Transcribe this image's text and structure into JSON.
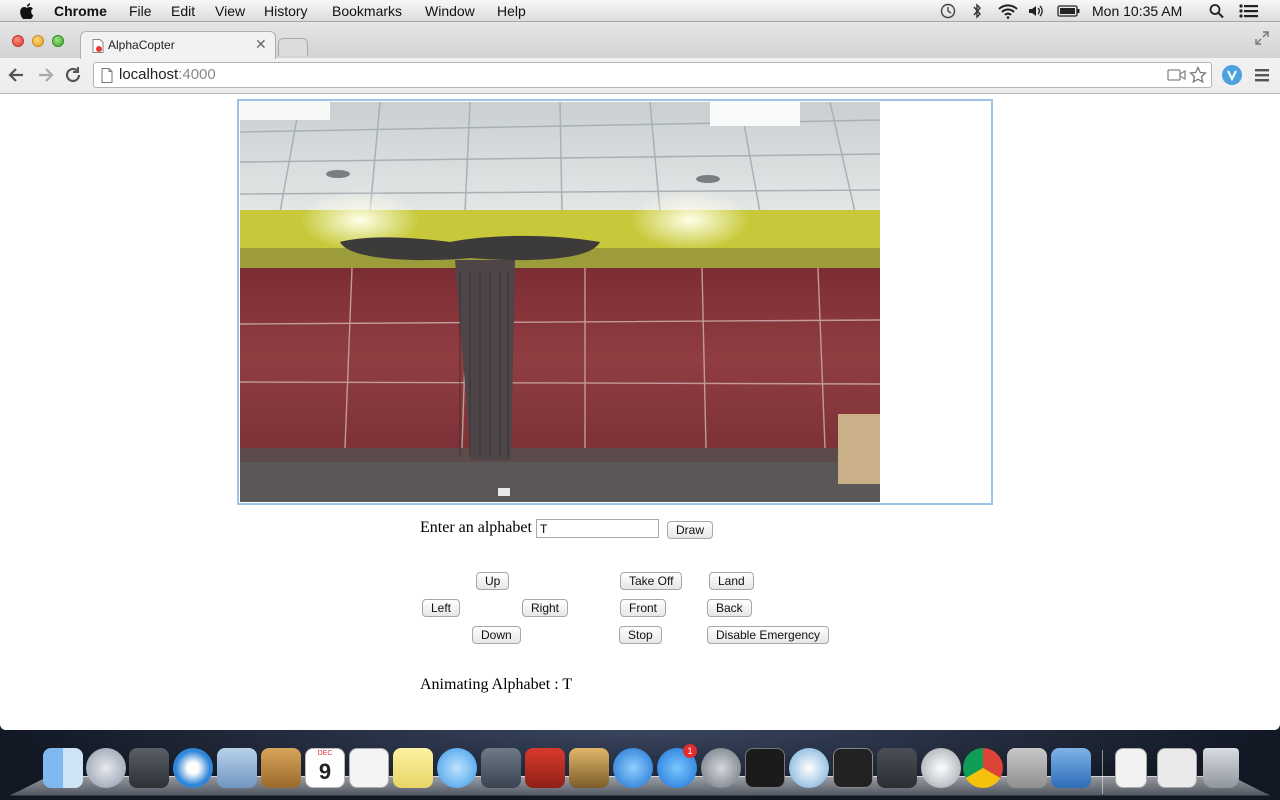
{
  "menubar": {
    "app_name": "Chrome",
    "menus": [
      "File",
      "Edit",
      "View",
      "History",
      "Bookmarks",
      "Window",
      "Help"
    ],
    "clock": "Mon 10:35 AM",
    "status_icons": [
      "time-machine-icon",
      "bluetooth-icon",
      "wifi-icon",
      "volume-icon",
      "battery-icon",
      "spotlight-icon",
      "notification-center-icon"
    ]
  },
  "browser": {
    "tab_title": "AlphaCopter",
    "url_host": "localhost",
    "url_port": ":4000"
  },
  "page": {
    "video_feed": "drone-camera-feed",
    "alphabet_label": "Enter an alphabet",
    "alphabet_value": "T",
    "draw_button": "Draw",
    "controls": {
      "up": "Up",
      "left": "Left",
      "right": "Right",
      "down": "Down",
      "take_off": "Take Off",
      "land": "Land",
      "front": "Front",
      "back": "Back",
      "stop": "Stop",
      "disable_emergency": "Disable Emergency"
    },
    "status": "Animating Alphabet : T"
  },
  "dock": {
    "calendar_day": "9",
    "calendar_month": "DEC",
    "app_store_badge": "1",
    "apps": [
      "finder",
      "launchpad",
      "photo-booth",
      "safari",
      "mail",
      "contacts",
      "calendar",
      "reminders",
      "notes",
      "messages",
      "facetime",
      "photo-booth-2",
      "iphoto",
      "itunes",
      "app-store",
      "system-preferences",
      "terminal",
      "sourcetree",
      "activity-monitor",
      "sublime-text",
      "sourcetree-2",
      "chrome",
      "calculator",
      "xcode",
      "archive",
      "mamp",
      "trash"
    ]
  },
  "colors": {
    "accent_blue": "#9fc3e8",
    "wall_red": "#8b3a3d",
    "ceiling_yellow": "#d7d84a"
  }
}
